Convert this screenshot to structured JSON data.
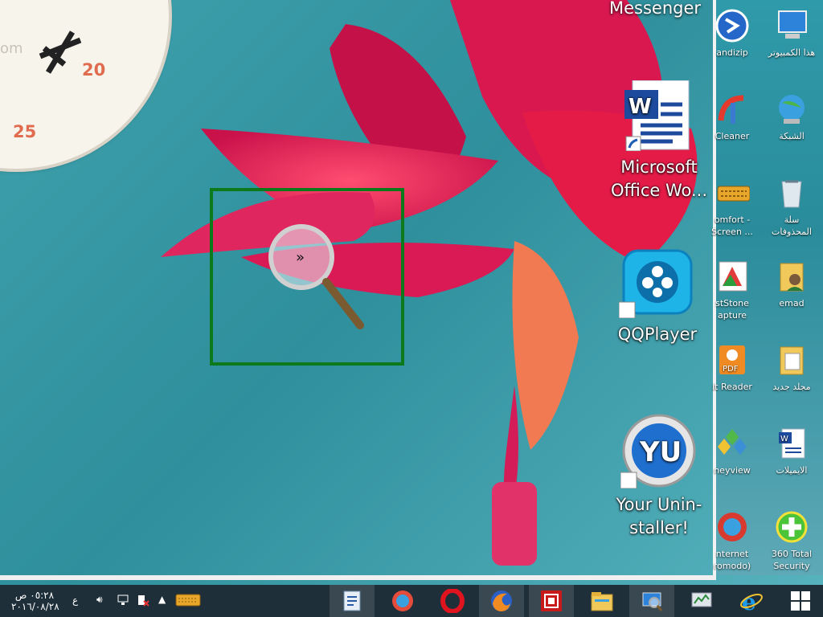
{
  "clock": {
    "numbers": [
      "20",
      "25"
    ],
    "partial_text": "om"
  },
  "top_label": "Messenger",
  "big_icons": [
    {
      "name": "word",
      "label": "Microsoft Office Wo..."
    },
    {
      "name": "qqplayer",
      "label": "QQPlayer"
    },
    {
      "name": "uninstaller",
      "label": "Your Unin-staller!"
    }
  ],
  "small_icons_left": [
    {
      "label": "andizip",
      "icon": "bandizip-icon"
    },
    {
      "label": "Cleaner",
      "icon": "ccleaner-icon"
    },
    {
      "label": "omfort -Screen ...",
      "icon": "keyboard-icon"
    },
    {
      "label": "stStone apture",
      "icon": "faststone-icon"
    },
    {
      "label": "it Reader",
      "icon": "pdf-icon"
    },
    {
      "label": "neyview",
      "icon": "honeyview-icon"
    },
    {
      "label": "nternet romodo)",
      "icon": "comodo-icon"
    }
  ],
  "small_icons_right": [
    {
      "label": "هذا الكمبيوتر",
      "icon": "computer-icon"
    },
    {
      "label": "الشبكة",
      "icon": "network-icon"
    },
    {
      "label": "سلة المحذوفات",
      "icon": "recycle-bin-icon"
    },
    {
      "label": "emad",
      "icon": "user-folder-icon"
    },
    {
      "label": "مجلد جديد",
      "icon": "folder-icon"
    },
    {
      "label": "الايميلات",
      "icon": "word-doc-icon"
    },
    {
      "label": "360 Total Security",
      "icon": "360-security-icon"
    }
  ],
  "taskbar": {
    "time": "٠٥:٢٨ ص",
    "date": "٢٠١٦/٠٨/٢٨",
    "lang": "ع"
  },
  "colors": {
    "taskbar": "#1e2f3a",
    "magnifier_frame": "#0c7a1a",
    "accent": "#e06b4f"
  }
}
